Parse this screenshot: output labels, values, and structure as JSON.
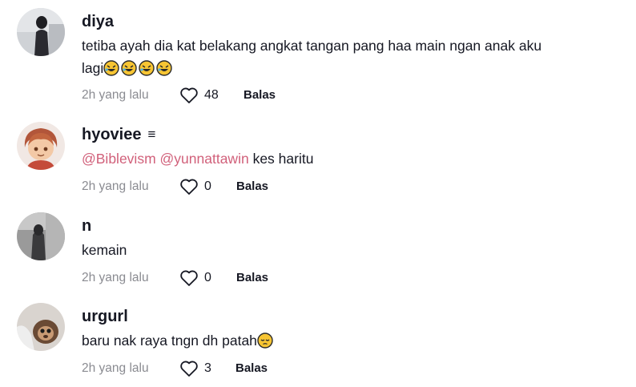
{
  "comments": [
    {
      "username": "diya",
      "text_line1": "tetiba ayah dia kat belakang angkat tangan pang haa main ngan anak aku",
      "text_line2": "lagi",
      "emojis": [
        "rolling-on-floor-laughing",
        "rolling-on-floor-laughing",
        "rolling-on-floor-laughing",
        "rolling-on-floor-laughing"
      ],
      "time": "2h yang lalu",
      "likes": "48",
      "reply": "Balas"
    },
    {
      "username": "hyoviee",
      "badge": "≡",
      "mention1": "@Biblevism",
      "mention2": "@yunnattawin",
      "text": "kes haritu",
      "time": "2h yang lalu",
      "likes": "0",
      "reply": "Balas"
    },
    {
      "username": "n",
      "text": "kemain",
      "time": "2h yang lalu",
      "likes": "0",
      "reply": "Balas"
    },
    {
      "username": "urgurl",
      "text": "baru nak raya tngn dh patah",
      "emojis": [
        "pensive-face"
      ],
      "time": "2h yang lalu",
      "likes": "3",
      "reply": "Balas"
    }
  ],
  "icons": {
    "like": "heart-outline-icon"
  },
  "colors": {
    "text": "#161823",
    "muted": "#8a8b91",
    "mention": "#d1607a"
  }
}
